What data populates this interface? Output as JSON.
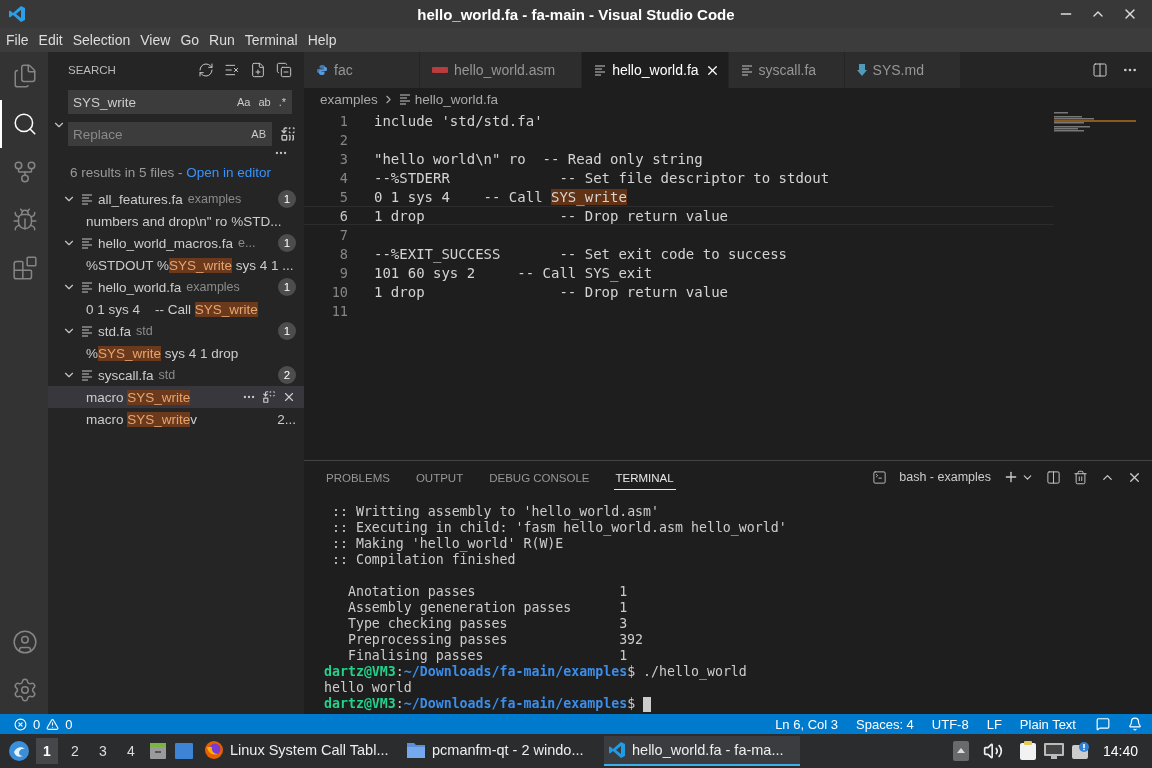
{
  "window": {
    "title": "hello_world.fa - fa-main - Visual Studio Code"
  },
  "menu": [
    "File",
    "Edit",
    "Selection",
    "View",
    "Go",
    "Run",
    "Terminal",
    "Help"
  ],
  "activity_bar": {
    "top": [
      {
        "kind": "explorer",
        "selected": false
      },
      {
        "kind": "search",
        "selected": true
      },
      {
        "kind": "scm",
        "selected": false
      },
      {
        "kind": "debug",
        "selected": false
      },
      {
        "kind": "extensions",
        "selected": false
      }
    ],
    "bottom": [
      {
        "kind": "accounts"
      },
      {
        "kind": "manage"
      }
    ]
  },
  "sidebar": {
    "title": "SEARCH",
    "query": "SYS_write",
    "query_options": [
      "Aa",
      "ab",
      ".*"
    ],
    "replace_placeholder": "Replace",
    "replace_option": "AB",
    "summary": "6 results in 5 files - ",
    "summary_link": "Open in editor",
    "results": [
      {
        "file": "all_features.fa",
        "folder": "examples",
        "count": "1",
        "expanded": true,
        "matches": [
          {
            "before": "numbers and drop\\n\" ro %STD...",
            "selected": false
          }
        ]
      },
      {
        "file": "hello_world_macros.fa",
        "folder": "e...",
        "count": "1",
        "expanded": true,
        "matches": [
          {
            "before": "%STDOUT %",
            "match": "SYS_write",
            "after": " sys 4 1 ...",
            "selected": false
          }
        ]
      },
      {
        "file": "hello_world.fa",
        "folder": "examples",
        "count": "1",
        "expanded": true,
        "matches": [
          {
            "before": "0 1 sys 4    -- Call ",
            "match": "SYS_write",
            "selected": false
          }
        ]
      },
      {
        "file": "std.fa",
        "folder": "std",
        "count": "1",
        "expanded": true,
        "matches": [
          {
            "before": "%",
            "match": "SYS_write",
            "after": " sys 4 1 drop",
            "selected": false
          }
        ]
      },
      {
        "file": "syscall.fa",
        "folder": "std",
        "count": "2",
        "expanded": true,
        "matches": [
          {
            "before": "macro ",
            "match": "SYS_write",
            "selected": true
          },
          {
            "before": "macro ",
            "match": "SYS_write",
            "after": "v",
            "trailing": "2...",
            "selected": false
          }
        ]
      }
    ]
  },
  "editor": {
    "tabs": [
      {
        "label": "fac",
        "kind": "python",
        "selected": false
      },
      {
        "label": "hello_world.asm",
        "kind": "asm",
        "selected": false
      },
      {
        "label": "hello_world.fa",
        "kind": "text",
        "selected": true
      },
      {
        "label": "syscall.fa",
        "kind": "text",
        "selected": false
      },
      {
        "label": "SYS.md",
        "kind": "markdown",
        "selected": false
      }
    ],
    "breadcrumb": [
      "examples",
      "hello_world.fa"
    ],
    "lines": [
      {
        "number": "1",
        "text": "include 'std/std.fa'",
        "current": false
      },
      {
        "number": "2",
        "current": false
      },
      {
        "number": "3",
        "text": "\"hello world\\n\" ro  -- Read only string",
        "current": false
      },
      {
        "number": "4",
        "text": "--%STDERR             -- Set file descriptor to stdout",
        "current": false
      },
      {
        "number": "5",
        "text": "0 1 sys 4    -- Call ",
        "match": "SYS_write",
        "current": false
      },
      {
        "number": "6",
        "text": "1 drop                -- Drop return value",
        "current": true
      },
      {
        "number": "7",
        "current": false
      },
      {
        "number": "8",
        "text": "--%EXIT_SUCCESS       -- Set exit code to success",
        "current": false
      },
      {
        "number": "9",
        "text": "101 60 sys 2     -- Call SYS_exit",
        "current": false
      },
      {
        "number": "10",
        "text": "1 drop                -- Drop return value",
        "current": false
      },
      {
        "number": "11",
        "current": false
      }
    ]
  },
  "panel": {
    "tabs": [
      {
        "label": "PROBLEMS",
        "selected": false
      },
      {
        "label": "OUTPUT",
        "selected": false
      },
      {
        "label": "DEBUG CONSOLE",
        "selected": false
      },
      {
        "label": "TERMINAL",
        "selected": true
      }
    ],
    "terminal_name": "bash - examples",
    "lines": [
      {
        "kind": "output",
        "text": " :: Writting assembly to 'hello_world.asm'"
      },
      {
        "kind": "output",
        "text": " :: Executing in child: 'fasm hello_world.asm hello_world'"
      },
      {
        "kind": "output",
        "text": " :: Making 'hello_world' R(W)E"
      },
      {
        "kind": "output",
        "text": " :: Compilation finished"
      },
      {
        "kind": "blank"
      },
      {
        "kind": "stat",
        "label": "Anotation passes",
        "value": "1"
      },
      {
        "kind": "stat",
        "label": "Assembly geneneration passes",
        "value": "1"
      },
      {
        "kind": "stat",
        "label": "Type checking passes",
        "value": "3"
      },
      {
        "kind": "stat",
        "label": "Preprocessing passes",
        "value": "392"
      },
      {
        "kind": "stat",
        "label": "Finalising passes",
        "value": "1"
      },
      {
        "kind": "prompt",
        "user": "dartz@VM3",
        "sep": ":",
        "path": "~/Downloads/fa-main/examples",
        "rest": "$ ./hello_world",
        "cursor": false
      },
      {
        "kind": "output",
        "text": "hello world"
      },
      {
        "kind": "prompt",
        "user": "dartz@VM3",
        "sep": ":",
        "path": "~/Downloads/fa-main/examples",
        "rest": "$ ",
        "cursor": true
      }
    ]
  },
  "status_bar": {
    "errors": "0",
    "warnings": "0",
    "items": [
      "Ln 6, Col 3",
      "Spaces: 4",
      "UTF-8",
      "LF",
      "Plain Text"
    ]
  },
  "taskbar": {
    "workspaces": [
      {
        "label": "1",
        "selected": true
      },
      {
        "label": "2",
        "selected": false
      },
      {
        "label": "3",
        "selected": false
      },
      {
        "label": "4",
        "selected": false
      }
    ],
    "tasks": [
      {
        "label": "Linux System Call Tabl...",
        "kind": "browser",
        "selected": false
      },
      {
        "label": "pcmanfm-qt - 2 windo...",
        "kind": "folder",
        "selected": false
      },
      {
        "label": "hello_world.fa - fa-ma...",
        "kind": "vscode",
        "selected": true
      }
    ],
    "clock": "14:40"
  }
}
